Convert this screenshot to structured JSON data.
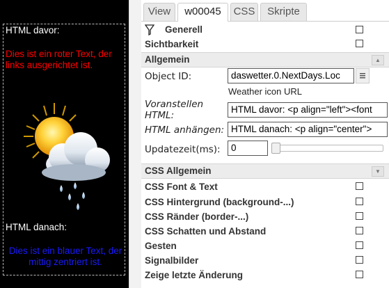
{
  "preview": {
    "html_before": "HTML davor:",
    "red_text": "Dies ist ein roter Text, der links ausgerichtet ist.",
    "html_after": "HTML danach:",
    "blue_text": "Dies ist ein blauer Text, der mittig zentriert ist.",
    "weather_icon": "sun-cloud-rain-icon"
  },
  "tabs": [
    "View",
    "w00045",
    "CSS",
    "Skripte"
  ],
  "active_tab": "w00045",
  "groups": {
    "generell": "Generell",
    "sichtbarkeit": "Sichtbarkeit",
    "allgemein": "Allgemein",
    "css_allgemein": "CSS Allgemein",
    "css_font": "CSS Font & Text",
    "css_hintergrund": "CSS Hintergrund (background-...)",
    "css_raender": "CSS Ränder (border-...)",
    "css_schatten": "CSS Schatten und Abstand",
    "gesten": "Gesten",
    "signalbilder": "Signalbilder",
    "zeige": "Zeige letzte Änderung"
  },
  "fields": {
    "object_id_label": "Object ID:",
    "object_id_value": "daswetter.0.NextDays.Loc",
    "object_id_hint": "Weather icon URL",
    "prepend_label": "Voranstellen HTML:",
    "prepend_value": "HTML davor: <p align=\"left\"><font",
    "append_label": "HTML anhängen:",
    "append_value": "HTML danach: <p align=\"center\">",
    "update_label": "Updatezeit(ms):",
    "update_value": "0"
  },
  "colors": {
    "red_text": "#ff0000",
    "blue_text": "#1a1aff",
    "preview_bg": "#000000"
  }
}
